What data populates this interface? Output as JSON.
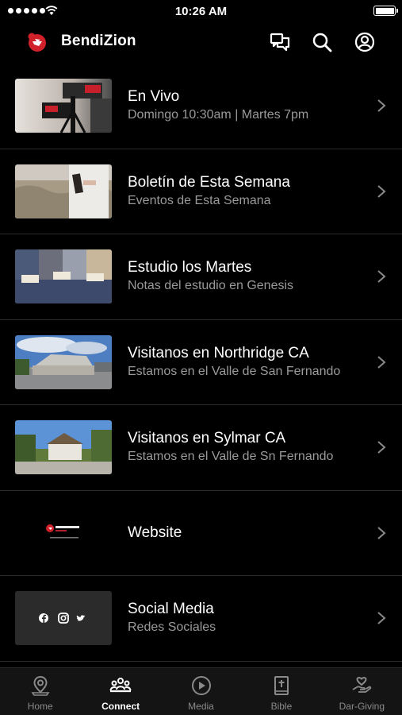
{
  "status_bar": {
    "time": "10:26 AM"
  },
  "header": {
    "app_name": "BendiZion"
  },
  "list": [
    {
      "title": "En Vivo",
      "subtitle": "Domingo 10:30am | Martes 7pm"
    },
    {
      "title": "Boletín de Esta Semana",
      "subtitle": "Eventos de Esta Semana"
    },
    {
      "title": "Estudio los Martes",
      "subtitle": "Notas del estudio en Genesis"
    },
    {
      "title": "Visitanos en Northridge CA",
      "subtitle": "Estamos en el Valle de San Fernando"
    },
    {
      "title": "Visitanos en Sylmar CA",
      "subtitle": "Estamos en el Valle de Sn Fernando"
    },
    {
      "title": "Website",
      "subtitle": ""
    },
    {
      "title": "Social Media",
      "subtitle": "Redes Sociales"
    }
  ],
  "tabs": [
    {
      "label": "Home",
      "icon": "location-pin-icon"
    },
    {
      "label": "Connect",
      "icon": "people-icon",
      "active": true
    },
    {
      "label": "Media",
      "icon": "play-circle-icon"
    },
    {
      "label": "Bible",
      "icon": "bible-icon"
    },
    {
      "label": "Dar-Giving",
      "icon": "giving-hand-icon"
    }
  ],
  "colors": {
    "background": "#000000",
    "brand_red": "#d0202a",
    "subtitle": "#9a9a9a",
    "tabbar": "#141414"
  }
}
